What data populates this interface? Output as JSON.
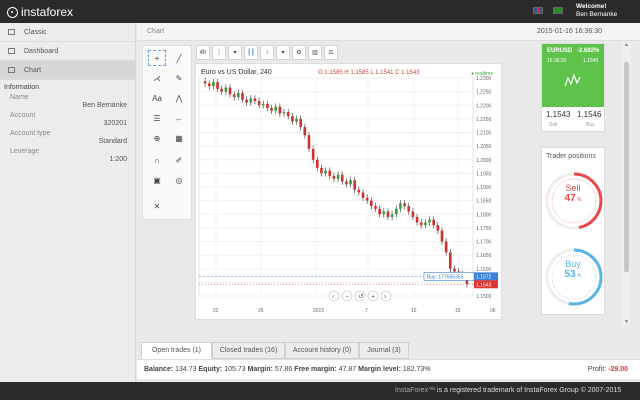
{
  "topbar": {
    "logo_text": "instaforex",
    "welcome_label": "Welcome!",
    "user_name": "Ben Bernanke",
    "flags": [
      "uk-flag",
      "mx-flag"
    ]
  },
  "sidebar": {
    "items": [
      {
        "label": "Classic",
        "icon": "classic-icon"
      },
      {
        "label": "Dashboard",
        "icon": "dashboard-icon"
      },
      {
        "label": "Chart",
        "icon": "chart-icon"
      }
    ],
    "info_title": "Information",
    "fields": [
      {
        "label": "Name",
        "value": "Ben Bernanke"
      },
      {
        "label": "Account",
        "value": "320201"
      },
      {
        "label": "Account type",
        "value": "Standard"
      },
      {
        "label": "Leverage",
        "value": "1:200"
      }
    ]
  },
  "header": {
    "title": "Chart",
    "clock": "2015-01-16 16:36:30"
  },
  "toolbar": {
    "timeframe": "4h",
    "buttons": [
      "menu-icon",
      "candles-icon",
      "bars-icon",
      "settings-icon",
      "indicators-icon",
      "compare-icon"
    ]
  },
  "chart": {
    "title": "Euro vs US Dollar, 240",
    "ohlc": "O 1.1585  H 1.1585  L 1.1541  C 1.1543",
    "status": "realtime",
    "buy_tag": "Buy: 177565363",
    "buy_price": "1.1572",
    "last_price": "1.1543"
  },
  "chart_data": {
    "type": "line",
    "title": "Euro vs US Dollar, 240",
    "x_ticks": [
      "22",
      "26",
      "2015",
      "7",
      "12",
      "15",
      "06"
    ],
    "y_ticks": [
      "1.2300",
      "1.2250",
      "1.2200",
      "1.2150",
      "1.2100",
      "1.2050",
      "1.2000",
      "1.1950",
      "1.1900",
      "1.1850",
      "1.1800",
      "1.1750",
      "1.1700",
      "1.1650",
      "1.1600",
      "1.1550",
      "1.1500"
    ],
    "ylim": [
      1.15,
      1.23
    ],
    "series": [
      {
        "values": [
          1.228,
          1.227,
          1.2285,
          1.226,
          1.225,
          1.2265,
          1.224,
          1.223,
          1.2245,
          1.222,
          1.221,
          1.2225,
          1.2215,
          1.22,
          1.2205,
          1.219,
          1.218,
          1.2195,
          1.217,
          1.2175,
          1.216,
          1.214,
          1.215,
          1.212,
          1.209,
          1.204,
          1.2,
          1.197,
          1.195,
          1.196,
          1.194,
          1.193,
          1.1945,
          1.192,
          1.191,
          1.1925,
          1.189,
          1.188,
          1.186,
          1.185,
          1.183,
          1.182,
          1.18,
          1.181,
          1.179,
          1.18,
          1.182,
          1.184,
          1.183,
          1.181,
          1.179,
          1.177,
          1.176,
          1.177,
          1.178,
          1.176,
          1.174,
          1.17,
          1.166,
          1.16,
          1.159,
          1.158,
          1.1572,
          1.1543
        ]
      }
    ]
  },
  "quote": {
    "symbol": "EURUSD",
    "change": "-2.682%",
    "time": "16:36:20",
    "value": "1.1545",
    "sell_price": "1.1543",
    "buy_price": "1.1546",
    "sell_label": "Sell",
    "buy_label": "Buy"
  },
  "trader_positions": {
    "title": "Trader positions",
    "sell_label": "Sell",
    "sell_pct": "47",
    "sell_fraction": 0.47,
    "buy_label": "Buy",
    "buy_pct": "53",
    "buy_fraction": 0.53,
    "sell_color": "#e84a4a",
    "buy_color": "#5ab4e6"
  },
  "tabs": [
    {
      "label": "Open trades (1)"
    },
    {
      "label": "Closed trades (16)"
    },
    {
      "label": "Account history (0)"
    },
    {
      "label": "Journal (3)"
    }
  ],
  "account": {
    "balance_label": "Balance:",
    "balance": "134.73",
    "equity_label": "Equity:",
    "equity": "105.73",
    "margin_label": "Margin:",
    "margin": "57.86",
    "free_margin_label": "Free margin:",
    "free_margin": "47.87",
    "margin_level_label": "Margin level:",
    "margin_level": "182.73%",
    "profit_label": "Profit:",
    "profit": "-29.00"
  },
  "footer": {
    "brand": "InstaForex™",
    "text": "is a registered trademark of InstaForex Group © 2007-2015"
  },
  "colors": {
    "green_card": "#5ec24b",
    "bull_candle": "#3c9a3c",
    "bear_candle": "#d03030"
  }
}
